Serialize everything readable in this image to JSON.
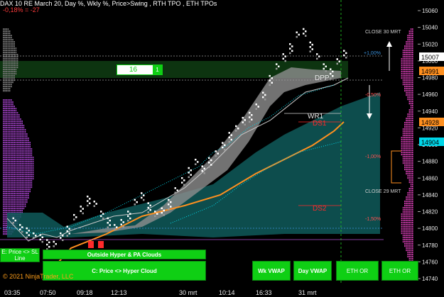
{
  "header": {
    "title": "DAX 10 RE March 20, Day %, Wkly %, Price>Swing , RTH TPO , ETH TPOs",
    "change": "-0,18% = -27"
  },
  "footer": {
    "copyright": "© 2021 NinjaTrader, LLC"
  },
  "price_axis": {
    "ticks": [
      "15060",
      "15040",
      "15020",
      "15000",
      "14980",
      "14960",
      "14940",
      "14920",
      "14900",
      "14880",
      "14860",
      "14840",
      "14820",
      "14800",
      "14780",
      "14760",
      "14740"
    ],
    "current_price": "15007",
    "level_orange": "14991",
    "level_orange2": "14928",
    "level_cyan": "14904"
  },
  "time_axis": {
    "ticks": [
      "03:35",
      "07:50",
      "09:18",
      "12:13",
      "30 mrt",
      "10:14",
      "16:33",
      "31 mrt"
    ]
  },
  "annotations": {
    "close_30": "CLOSE 30 MRT",
    "close_29": "CLOSE 29 MRT",
    "pct_1": "+1,00%",
    "pct_2": "-0,50%",
    "pct_3": "-1,00%",
    "pct_4": "-1,50%",
    "dpp": "DPP",
    "wr1": "WR1",
    "ds1": "DS1",
    "ds2": "DS2",
    "tag_left_1": "15000",
    "tag_left_2": "14928"
  },
  "counter": {
    "value": "16",
    "box": "1"
  },
  "buttons": {
    "price_sl": "E: Price <> SL Line",
    "outside_hyper": "Outside Hyper & PA Clouds",
    "price_hyper": "C: Price <> Hyper Cloud",
    "wk_vwap": "Wk VWAP",
    "day_vwap": "Day VWAP",
    "eth_or": "ETH OR",
    "eth_or2": "ETH OR"
  },
  "colors": {
    "green": "#0fcf14",
    "orange": "#ff9020",
    "cyan": "#00d6e8",
    "purple": "#9b3fbf",
    "teal": "#0f5a5a",
    "red": "#ff2b2b"
  },
  "chart_data": {
    "type": "scatter",
    "symbol": "DAX",
    "ylim": [
      14740,
      15060
    ],
    "y_ticks": [
      15060,
      15040,
      15020,
      15000,
      14980,
      14960,
      14940,
      14920,
      14900,
      14880,
      14860,
      14840,
      14820,
      14800,
      14780,
      14760,
      14740
    ],
    "x_ticks": [
      "03:35",
      "07:50",
      "09:18",
      "12:13",
      "30 mrt",
      "10:14",
      "16:33",
      "31 mrt"
    ],
    "points": [
      [
        0.02,
        14808
      ],
      [
        0.04,
        14800
      ],
      [
        0.06,
        14796
      ],
      [
        0.08,
        14790
      ],
      [
        0.1,
        14788
      ],
      [
        0.12,
        14782
      ],
      [
        0.14,
        14780
      ],
      [
        0.16,
        14790
      ],
      [
        0.18,
        14798
      ],
      [
        0.2,
        14812
      ],
      [
        0.22,
        14822
      ],
      [
        0.24,
        14834
      ],
      [
        0.26,
        14828
      ],
      [
        0.28,
        14816
      ],
      [
        0.3,
        14808
      ],
      [
        0.32,
        14800
      ],
      [
        0.34,
        14806
      ],
      [
        0.36,
        14816
      ],
      [
        0.38,
        14830
      ],
      [
        0.4,
        14838
      ],
      [
        0.42,
        14826
      ],
      [
        0.44,
        14816
      ],
      [
        0.46,
        14820
      ],
      [
        0.48,
        14830
      ],
      [
        0.5,
        14844
      ],
      [
        0.52,
        14856
      ],
      [
        0.54,
        14868
      ],
      [
        0.56,
        14878
      ],
      [
        0.58,
        14870
      ],
      [
        0.6,
        14880
      ],
      [
        0.62,
        14888
      ],
      [
        0.64,
        14898
      ],
      [
        0.66,
        14910
      ],
      [
        0.68,
        14918
      ],
      [
        0.7,
        14928
      ],
      [
        0.72,
        14934
      ],
      [
        0.74,
        14944
      ],
      [
        0.76,
        14958
      ],
      [
        0.78,
        14978
      ],
      [
        0.8,
        14992
      ],
      [
        0.82,
        15004
      ],
      [
        0.84,
        15016
      ],
      [
        0.86,
        15030
      ],
      [
        0.88,
        15034
      ],
      [
        0.9,
        15018
      ],
      [
        0.92,
        15004
      ],
      [
        0.94,
        14992
      ],
      [
        0.96,
        14986
      ],
      [
        0.98,
        14998
      ],
      [
        1.0,
        15008
      ]
    ]
  }
}
